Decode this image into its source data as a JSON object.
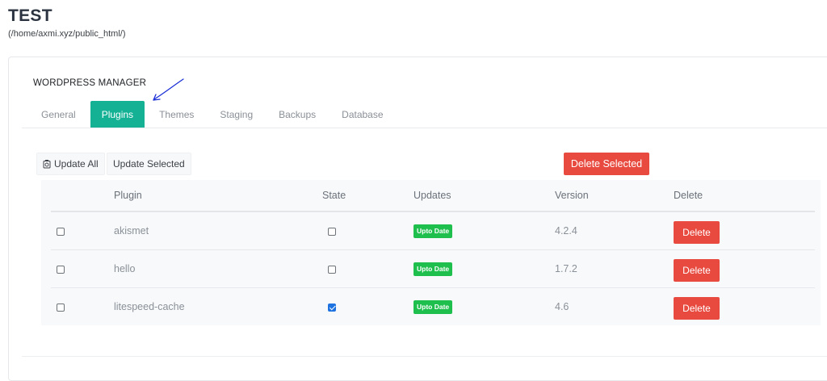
{
  "site": {
    "title": "TEST",
    "path": "(/home/axmi.xyz/public_html/)"
  },
  "manager": {
    "title": "WORDPRESS MANAGER"
  },
  "tabs": [
    {
      "label": "General",
      "active": false
    },
    {
      "label": "Plugins",
      "active": true
    },
    {
      "label": "Themes",
      "active": false
    },
    {
      "label": "Staging",
      "active": false
    },
    {
      "label": "Backups",
      "active": false
    },
    {
      "label": "Database",
      "active": false
    }
  ],
  "toolbar": {
    "update_all": "Update All",
    "update_selected": "Update Selected",
    "delete_selected": "Delete Selected"
  },
  "table": {
    "headers": {
      "select": "",
      "plugin": "Plugin",
      "state": "State",
      "updates": "Updates",
      "version": "Version",
      "delete": "Delete"
    },
    "rows": [
      {
        "plugin": "akismet",
        "state_checked": false,
        "updates": "Upto Date",
        "version": "4.2.4",
        "delete": "Delete"
      },
      {
        "plugin": "hello",
        "state_checked": false,
        "updates": "Upto Date",
        "version": "1.7.2",
        "delete": "Delete"
      },
      {
        "plugin": "litespeed-cache",
        "state_checked": true,
        "updates": "Upto Date",
        "version": "4.6",
        "delete": "Delete"
      }
    ]
  },
  "colors": {
    "accent": "#14b195",
    "danger": "#e84a3f",
    "badge": "#1fbf4e",
    "checkbox": "#1f73e0",
    "annotation_arrow": "#1b2fd6"
  }
}
